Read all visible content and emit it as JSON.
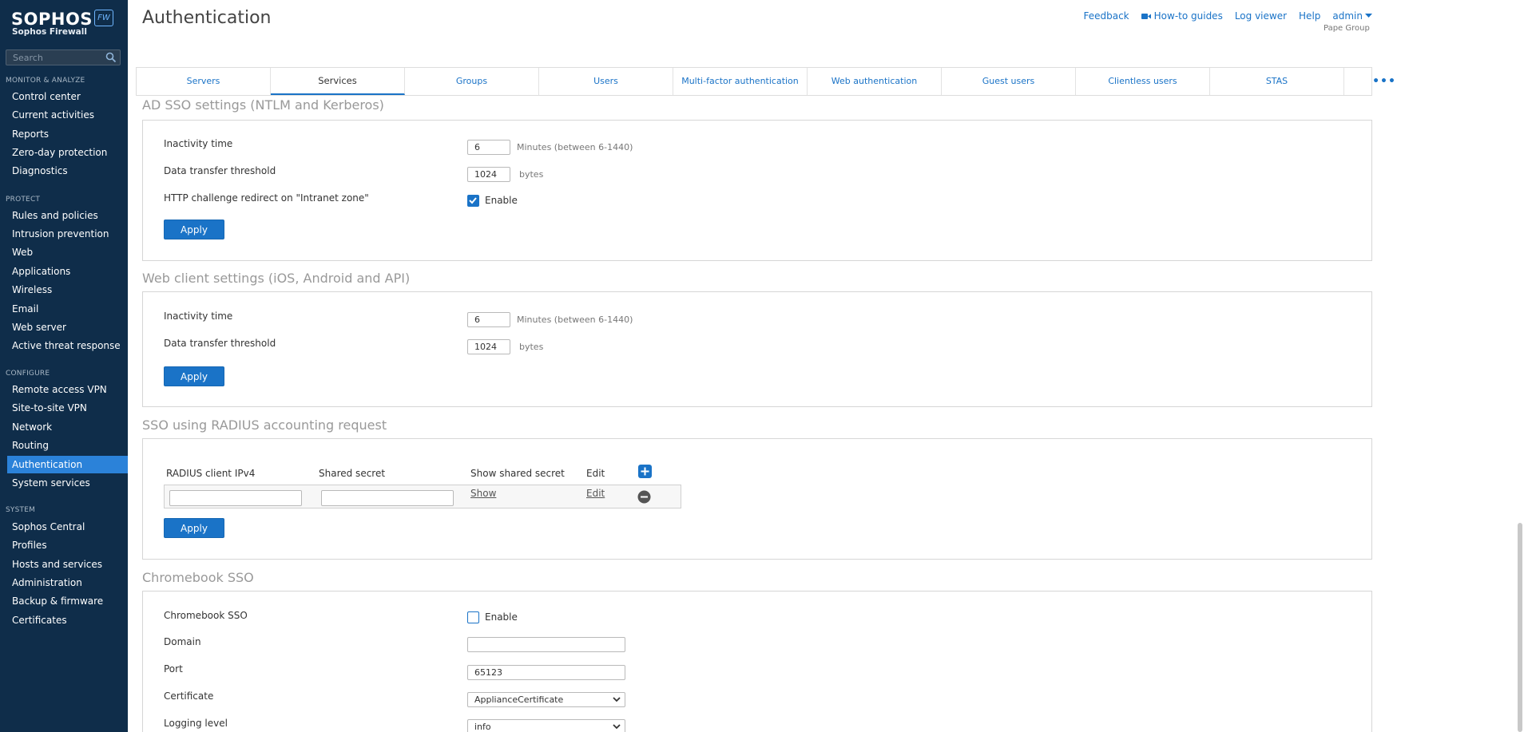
{
  "brand": {
    "name": "SOPHOS",
    "product": "Sophos Firewall",
    "badge": "FW"
  },
  "search": {
    "placeholder": "Search"
  },
  "nav": {
    "sections": [
      {
        "title": "MONITOR & ANALYZE",
        "items": [
          "Control center",
          "Current activities",
          "Reports",
          "Zero-day protection",
          "Diagnostics"
        ]
      },
      {
        "title": "PROTECT",
        "items": [
          "Rules and policies",
          "Intrusion prevention",
          "Web",
          "Applications",
          "Wireless",
          "Email",
          "Web server",
          "Active threat response"
        ]
      },
      {
        "title": "CONFIGURE",
        "items": [
          "Remote access VPN",
          "Site-to-site VPN",
          "Network",
          "Routing",
          "Authentication",
          "System services"
        ]
      },
      {
        "title": "SYSTEM",
        "items": [
          "Sophos Central",
          "Profiles",
          "Hosts and services",
          "Administration",
          "Backup & firmware",
          "Certificates"
        ]
      }
    ],
    "active": "Authentication"
  },
  "header": {
    "title": "Authentication",
    "links": {
      "feedback": "Feedback",
      "howto": "How-to guides",
      "log_viewer": "Log viewer",
      "help": "Help",
      "admin": "admin"
    },
    "org": "Pape Group"
  },
  "tabs": [
    "Servers",
    "Services",
    "Groups",
    "Users",
    "Multi-factor authentication",
    "Web authentication",
    "Guest users",
    "Clientless users",
    "STAS",
    "•••"
  ],
  "active_tab": "Services",
  "ad_sso": {
    "title": "AD SSO settings (NTLM and Kerberos)",
    "inactivity_label": "Inactivity time",
    "inactivity_value": "6",
    "inactivity_unit": "Minutes (between 6-1440)",
    "threshold_label": "Data transfer threshold",
    "threshold_value": "1024",
    "threshold_unit": "bytes",
    "http_label": "HTTP challenge redirect on \"Intranet zone\"",
    "http_enable_label": "Enable",
    "http_enabled": true,
    "apply": "Apply"
  },
  "web_client": {
    "title": "Web client settings (iOS, Android and API)",
    "inactivity_label": "Inactivity time",
    "inactivity_value": "6",
    "inactivity_unit": "Minutes (between 6-1440)",
    "threshold_label": "Data transfer threshold",
    "threshold_value": "1024",
    "threshold_unit": "bytes",
    "apply": "Apply"
  },
  "radius": {
    "title": "SSO using RADIUS accounting request",
    "columns": [
      "RADIUS client IPv4",
      "Shared secret",
      "Show shared secret",
      "Edit"
    ],
    "row": {
      "show": "Show",
      "edit": "Edit"
    },
    "apply": "Apply"
  },
  "chromebook": {
    "title": "Chromebook SSO",
    "sso_label": "Chromebook SSO",
    "enable_label": "Enable",
    "enabled": false,
    "domain_label": "Domain",
    "domain_value": "",
    "port_label": "Port",
    "port_value": "65123",
    "certificate_label": "Certificate",
    "certificate_value": "ApplianceCertificate",
    "logging_label": "Logging level",
    "logging_value": "info"
  },
  "colors": {
    "sidebar": "#0f2d4a",
    "accent": "#1a73c7",
    "active_nav": "#2b82d9"
  }
}
